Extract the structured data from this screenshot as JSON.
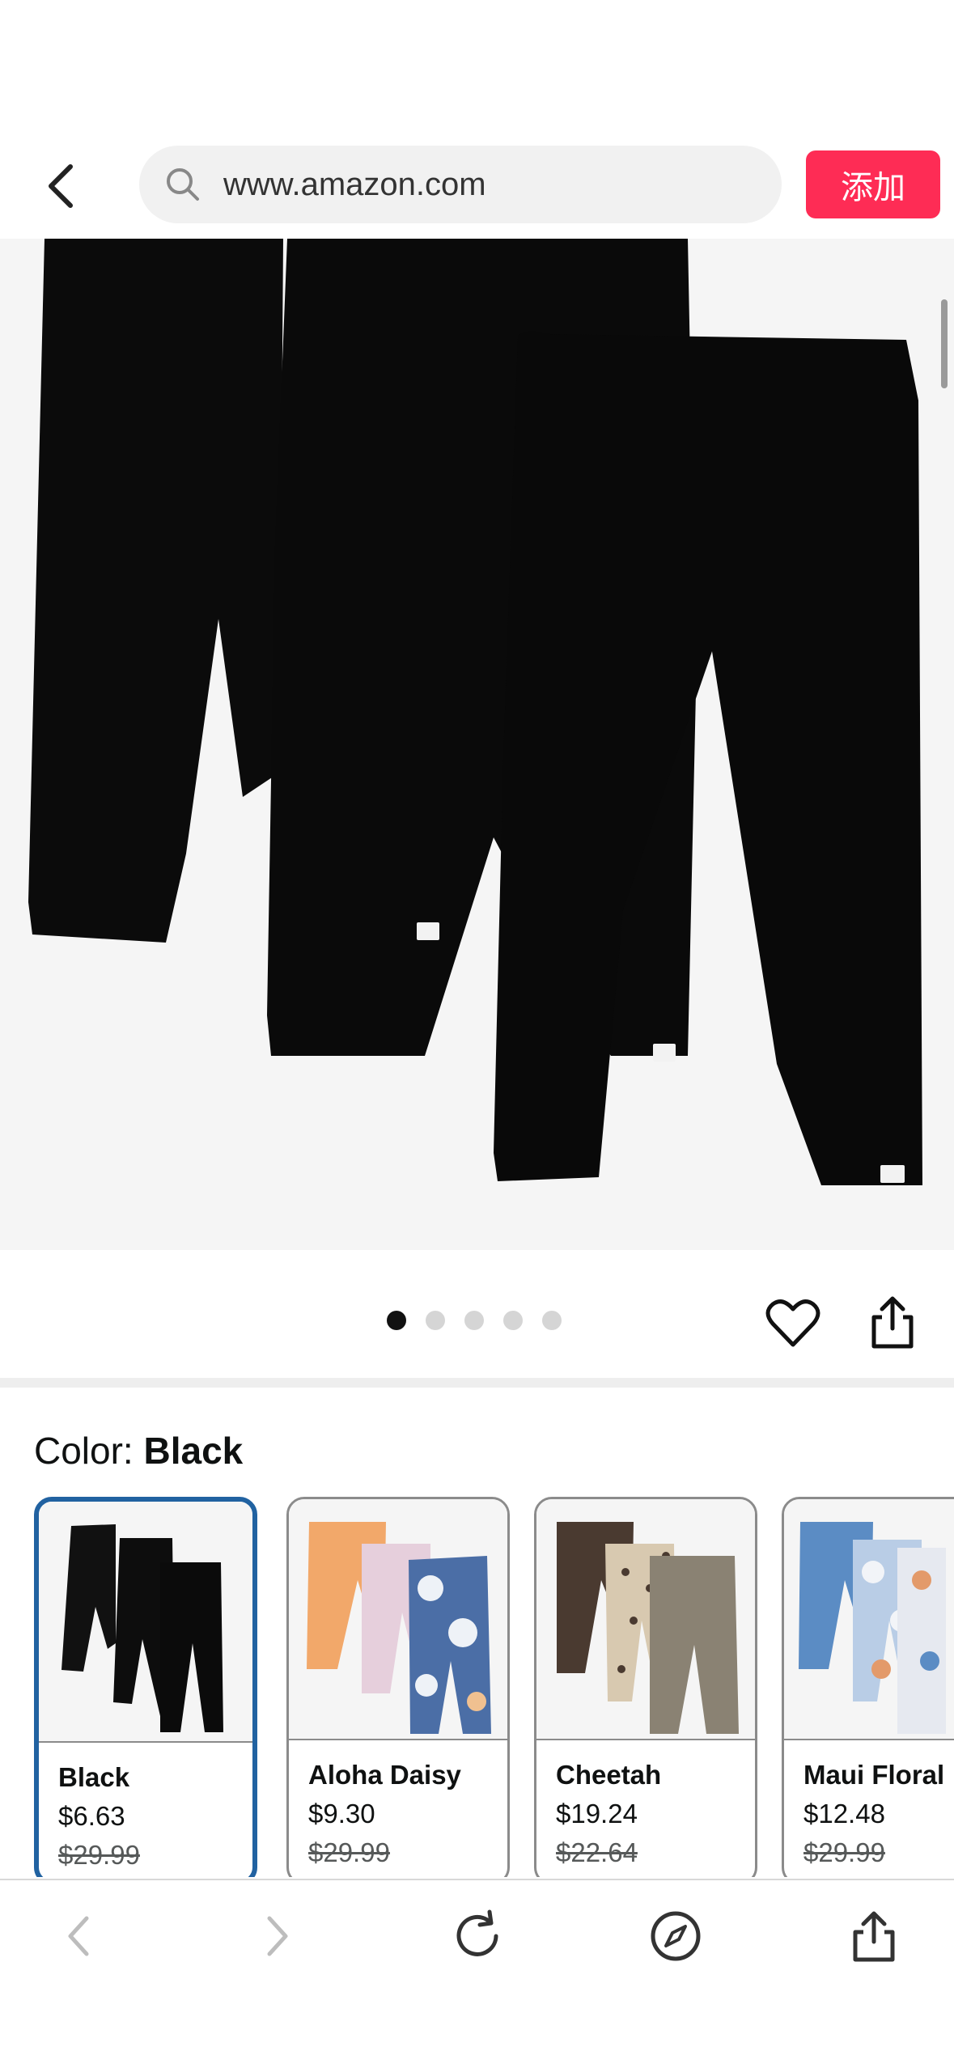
{
  "header": {
    "url": "www.amazon.com",
    "add_button_label": "添加"
  },
  "product": {
    "image_count": 5,
    "active_image_index": 0
  },
  "color": {
    "label": "Color:",
    "selected": "Black"
  },
  "swatches": [
    {
      "name": "Black",
      "price": "$6.63",
      "list_price": "$29.99",
      "selected": true
    },
    {
      "name": "Aloha Daisy",
      "price": "$9.30",
      "list_price": "$29.99",
      "selected": false
    },
    {
      "name": "Cheetah",
      "price": "$19.24",
      "list_price": "$22.64",
      "selected": false
    },
    {
      "name": "Maui Floral",
      "price": "$12.48",
      "list_price": "$29.99",
      "selected": false
    }
  ],
  "colors": {
    "accent_red": "#fe2c55",
    "selected_border": "#2162a1"
  },
  "icons": [
    "chevron-left-icon",
    "search-icon",
    "heart-icon",
    "share-icon",
    "back-icon",
    "forward-icon",
    "reload-icon",
    "compass-icon",
    "share-icon"
  ]
}
